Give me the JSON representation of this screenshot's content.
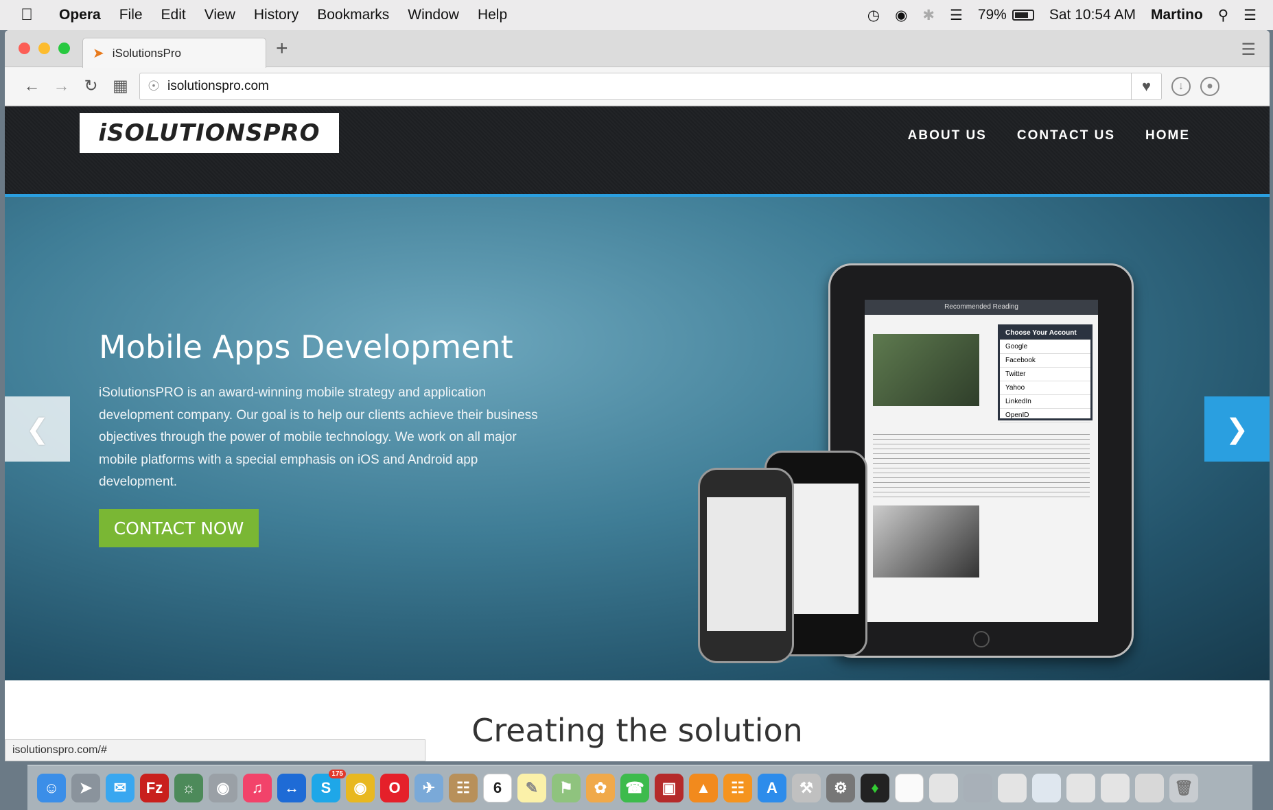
{
  "menubar": {
    "app": "Opera",
    "menus": [
      "File",
      "Edit",
      "View",
      "History",
      "Bookmarks",
      "Window",
      "Help"
    ],
    "battery_percent": "79%",
    "battery_level": 0.79,
    "clock": "Sat 10:54 AM",
    "user": "Martino"
  },
  "browser": {
    "tab_title": "iSolutionsPro",
    "url": "isolutionspro.com",
    "status_url": "isolutionspro.com/#"
  },
  "site": {
    "logo_text": "iSOLUTIONSPRO",
    "nav": [
      "ABOUT US",
      "CONTACT US",
      "HOME"
    ],
    "hero_title": "Mobile Apps Development",
    "hero_text": "iSolutionsPRO is an award-winning mobile strategy and application development company. Our goal is to help our clients achieve their business objectives through the power of mobile technology. We work on all major mobile platforms with a special emphasis on iOS and Android app development.",
    "cta_label": "CONTACT NOW",
    "section_title": "Creating the solution"
  },
  "tablet_screen": {
    "header": "Recommended Reading",
    "popup_title": "Choose Your Account",
    "accounts": [
      "Google",
      "Facebook",
      "Twitter",
      "Yahoo",
      "LinkedIn",
      "OpenID"
    ]
  },
  "dock": {
    "badge": "175",
    "calendar_day": "6"
  },
  "colors": {
    "accent": "#2a9fe0",
    "cta": "#7ab734",
    "header_bg": "#1d1f22"
  }
}
